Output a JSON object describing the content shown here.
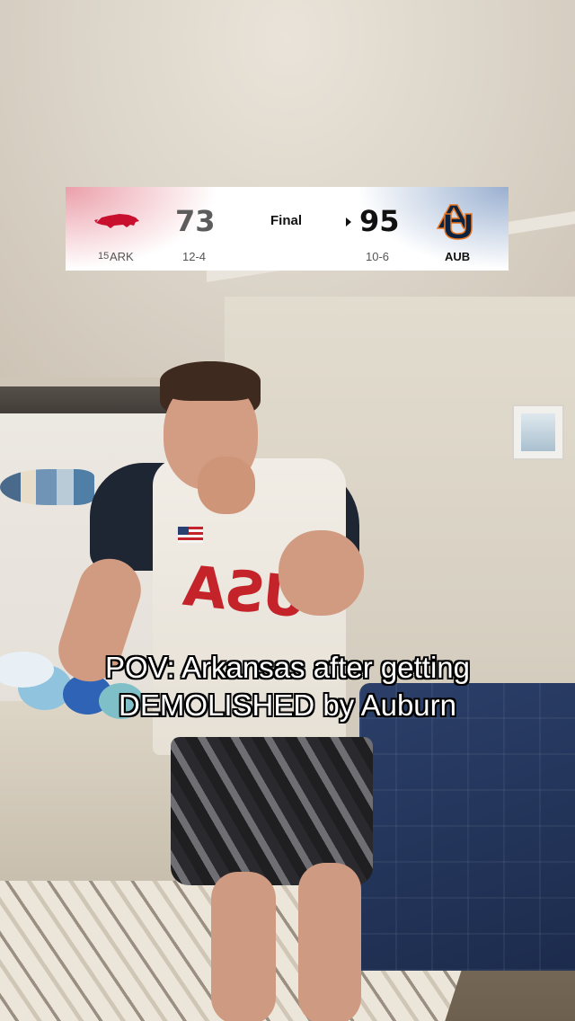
{
  "scoreboard": {
    "home_team": {
      "rank": "15",
      "abbr": "ARK",
      "score": "73",
      "record": "12-4",
      "color": "#c8102e"
    },
    "away_team": {
      "abbr": "AUB",
      "score": "95",
      "record": "10-6",
      "color": "#0c2340",
      "accent": "#e87722"
    },
    "status": "Final"
  },
  "caption": {
    "line1": "POV: Arkansas after getting",
    "line2": "DEMOLISHED by Auburn"
  },
  "jersey_text": "USA"
}
